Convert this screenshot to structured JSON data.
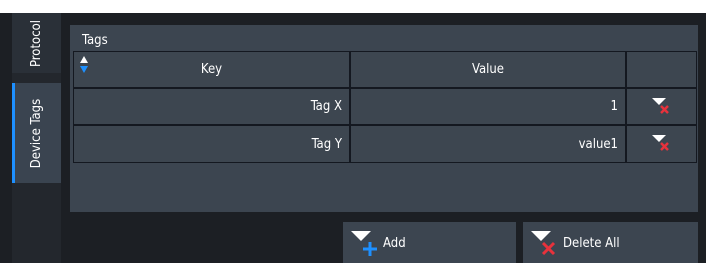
{
  "side_tabs": [
    {
      "label": "Protocol"
    },
    {
      "label": "Device Tags"
    }
  ],
  "panel": {
    "title": "Tags",
    "columns": [
      "Key",
      "Value"
    ],
    "rows": [
      {
        "key": "Tag X",
        "value": "1"
      },
      {
        "key": "Tag Y",
        "value": "value1"
      }
    ]
  },
  "buttons": {
    "add": "Add",
    "delete_all": "Delete All"
  },
  "colors": {
    "accent": "#1e90ff",
    "delete": "#e8323c"
  }
}
